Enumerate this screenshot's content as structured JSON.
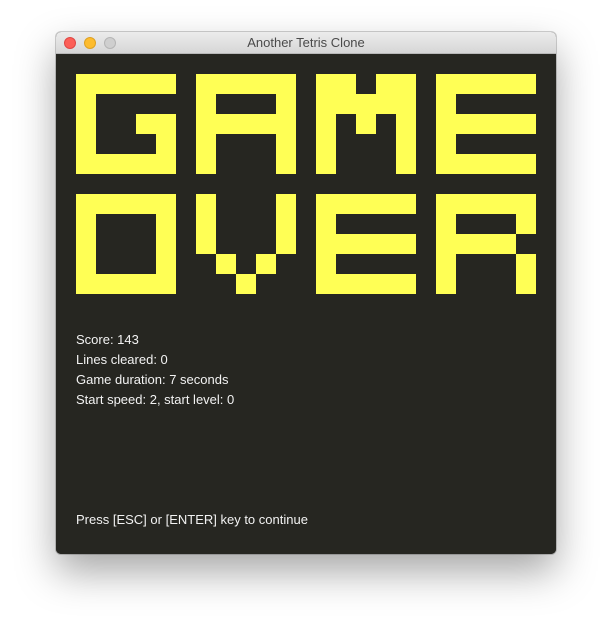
{
  "window": {
    "title": "Another Tetris Clone"
  },
  "colors": {
    "background": "#262621",
    "block": "#FFFF55",
    "text": "#F2F2F2"
  },
  "banner": {
    "line1": "GAME",
    "line2": "OVER"
  },
  "stats": {
    "score": "Score: 143",
    "lines": "Lines cleared: 0",
    "duration": "Game duration: 7 seconds",
    "start": "Start speed: 2, start level: 0"
  },
  "prompt": "Press [ESC] or [ENTER] key to continue"
}
